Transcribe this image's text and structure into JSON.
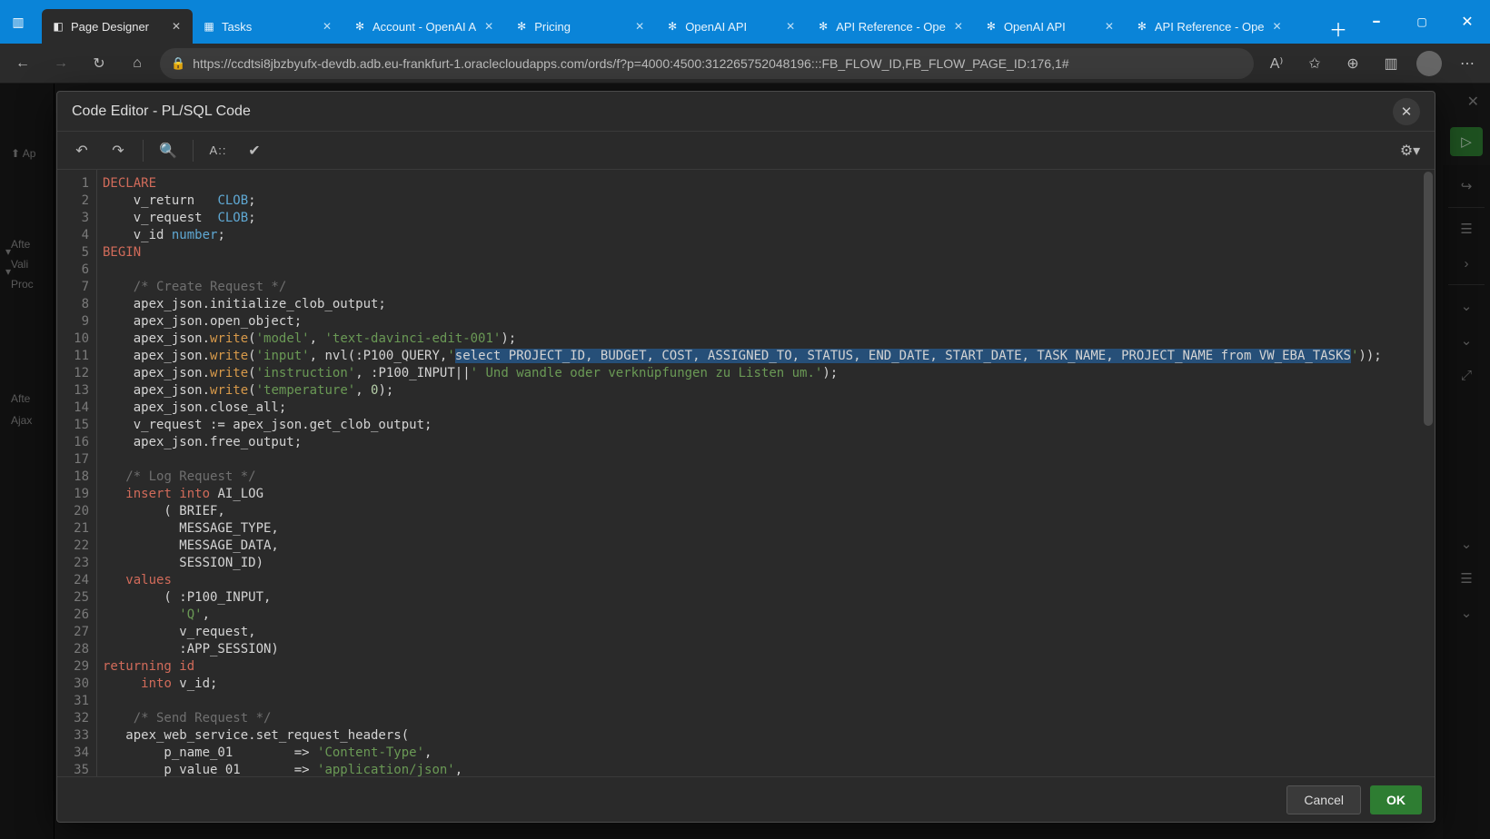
{
  "browser": {
    "tabs": [
      {
        "label": "Page Designer",
        "active": true,
        "fav": "◧"
      },
      {
        "label": "Tasks",
        "active": false,
        "fav": "▦"
      },
      {
        "label": "Account - OpenAI A",
        "active": false,
        "fav": "✻"
      },
      {
        "label": "Pricing",
        "active": false,
        "fav": "✻"
      },
      {
        "label": "OpenAI API",
        "active": false,
        "fav": "✻"
      },
      {
        "label": "API Reference - Ope",
        "active": false,
        "fav": "✻"
      },
      {
        "label": "OpenAI API",
        "active": false,
        "fav": "✻"
      },
      {
        "label": "API Reference - Ope",
        "active": false,
        "fav": "✻"
      }
    ],
    "url": "https://ccdtsi8jbzbyufx-devdb.adb.eu-frankfurt-1.oraclecloudapps.com/ords/f?p=4000:4500:312265752048196:::FB_FLOW_ID,FB_FLOW_PAGE_ID:176,1#"
  },
  "designer": {
    "left_items": [
      "Ap",
      "",
      "",
      "Afte",
      "Vali",
      "Proc",
      "",
      "Afte",
      "Ajax"
    ]
  },
  "dialog": {
    "title": "Code Editor - PL/SQL Code",
    "toolbar_text": "A::",
    "cancel": "Cancel",
    "ok": "OK"
  },
  "code": {
    "lines": [
      {
        "n": 1,
        "tokens": [
          [
            "kw",
            "DECLARE"
          ]
        ]
      },
      {
        "n": 2,
        "tokens": [
          [
            "",
            "    v_return   "
          ],
          [
            "type",
            "CLOB"
          ],
          [
            "",
            ";"
          ]
        ]
      },
      {
        "n": 3,
        "tokens": [
          [
            "",
            "    v_request  "
          ],
          [
            "type",
            "CLOB"
          ],
          [
            "",
            ";"
          ]
        ]
      },
      {
        "n": 4,
        "tokens": [
          [
            "",
            "    v_id "
          ],
          [
            "type",
            "number"
          ],
          [
            "",
            ";"
          ]
        ]
      },
      {
        "n": 5,
        "tokens": [
          [
            "kw",
            "BEGIN"
          ]
        ]
      },
      {
        "n": 6,
        "tokens": [
          [
            "",
            ""
          ]
        ]
      },
      {
        "n": 7,
        "tokens": [
          [
            "",
            "    "
          ],
          [
            "comment",
            "/* Create Request */"
          ]
        ]
      },
      {
        "n": 8,
        "tokens": [
          [
            "",
            "    apex_json.initialize_clob_output;"
          ]
        ]
      },
      {
        "n": 9,
        "tokens": [
          [
            "",
            "    apex_json.open_object;"
          ]
        ]
      },
      {
        "n": 10,
        "tokens": [
          [
            "",
            "    apex_json."
          ],
          [
            "method",
            "write"
          ],
          [
            "",
            "("
          ],
          [
            "str",
            "'model'"
          ],
          [
            "",
            ", "
          ],
          [
            "str",
            "'text-davinci-edit-001'"
          ],
          [
            "",
            ");"
          ]
        ]
      },
      {
        "n": 11,
        "tokens": [
          [
            "",
            "    apex_json."
          ],
          [
            "method",
            "write"
          ],
          [
            "",
            "("
          ],
          [
            "str",
            "'input'"
          ],
          [
            "",
            ", nvl(:P100_QUERY,"
          ],
          [
            "str",
            "'"
          ],
          [
            "sel",
            "select PROJECT_ID, BUDGET, COST, ASSIGNED_TO, STATUS, END_DATE, START_DATE, TASK_NAME, PROJECT_NAME from VW_EBA_TASKS"
          ],
          [
            "str",
            "'"
          ],
          [
            "",
            "));"
          ]
        ]
      },
      {
        "n": 12,
        "tokens": [
          [
            "",
            "    apex_json."
          ],
          [
            "method",
            "write"
          ],
          [
            "",
            "("
          ],
          [
            "str",
            "'instruction'"
          ],
          [
            "",
            ", :P100_INPUT||"
          ],
          [
            "str",
            "' Und wandle oder verknüpfungen zu Listen um.'"
          ],
          [
            "",
            ");"
          ]
        ]
      },
      {
        "n": 13,
        "tokens": [
          [
            "",
            "    apex_json."
          ],
          [
            "method",
            "write"
          ],
          [
            "",
            "("
          ],
          [
            "str",
            "'temperature'"
          ],
          [
            "",
            ", "
          ],
          [
            "num",
            "0"
          ],
          [
            "",
            ");"
          ]
        ]
      },
      {
        "n": 14,
        "tokens": [
          [
            "",
            "    apex_json.close_all;"
          ]
        ]
      },
      {
        "n": 15,
        "tokens": [
          [
            "",
            "    v_request := apex_json.get_clob_output;"
          ]
        ]
      },
      {
        "n": 16,
        "tokens": [
          [
            "",
            "    apex_json.free_output;"
          ]
        ]
      },
      {
        "n": 17,
        "tokens": [
          [
            "",
            ""
          ]
        ]
      },
      {
        "n": 18,
        "tokens": [
          [
            "",
            "   "
          ],
          [
            "comment",
            "/* Log Request */"
          ]
        ]
      },
      {
        "n": 19,
        "tokens": [
          [
            "",
            "   "
          ],
          [
            "kw",
            "insert"
          ],
          [
            "",
            ""
          ],
          [
            "",
            " "
          ],
          [
            "kw",
            "into"
          ],
          [
            "",
            " AI_LOG"
          ]
        ]
      },
      {
        "n": 20,
        "tokens": [
          [
            "",
            "        ( BRIEF,"
          ]
        ]
      },
      {
        "n": 21,
        "tokens": [
          [
            "",
            "          MESSAGE_TYPE,"
          ]
        ]
      },
      {
        "n": 22,
        "tokens": [
          [
            "",
            "          MESSAGE_DATA,"
          ]
        ]
      },
      {
        "n": 23,
        "tokens": [
          [
            "",
            "          SESSION_ID)"
          ]
        ]
      },
      {
        "n": 24,
        "tokens": [
          [
            "",
            "   "
          ],
          [
            "kw",
            "values"
          ]
        ]
      },
      {
        "n": 25,
        "tokens": [
          [
            "",
            "        ( :P100_INPUT,"
          ]
        ]
      },
      {
        "n": 26,
        "tokens": [
          [
            "",
            "          "
          ],
          [
            "str",
            "'Q'"
          ],
          [
            "",
            ","
          ]
        ]
      },
      {
        "n": 27,
        "tokens": [
          [
            "",
            "          v_request,"
          ]
        ]
      },
      {
        "n": 28,
        "tokens": [
          [
            "",
            "          :APP_SESSION)"
          ]
        ]
      },
      {
        "n": 29,
        "tokens": [
          [
            "kw",
            "returning"
          ],
          [
            "",
            " "
          ],
          [
            "kw",
            "id"
          ]
        ]
      },
      {
        "n": 30,
        "tokens": [
          [
            "",
            "     "
          ],
          [
            "kw",
            "into"
          ],
          [
            "",
            " v_id;"
          ]
        ]
      },
      {
        "n": 31,
        "tokens": [
          [
            "",
            ""
          ]
        ]
      },
      {
        "n": 32,
        "tokens": [
          [
            "",
            "    "
          ],
          [
            "comment",
            "/* Send Request */"
          ]
        ]
      },
      {
        "n": 33,
        "tokens": [
          [
            "",
            "   apex_web_service.set_request_headers("
          ]
        ]
      },
      {
        "n": 34,
        "tokens": [
          [
            "",
            "        p_name_01        => "
          ],
          [
            "str",
            "'Content-Type'"
          ],
          [
            "",
            ","
          ]
        ]
      },
      {
        "n": 35,
        "tokens": [
          [
            "",
            "        p_value_01       => "
          ],
          [
            "str",
            "'application/json'"
          ],
          [
            "",
            ","
          ]
        ]
      }
    ]
  }
}
